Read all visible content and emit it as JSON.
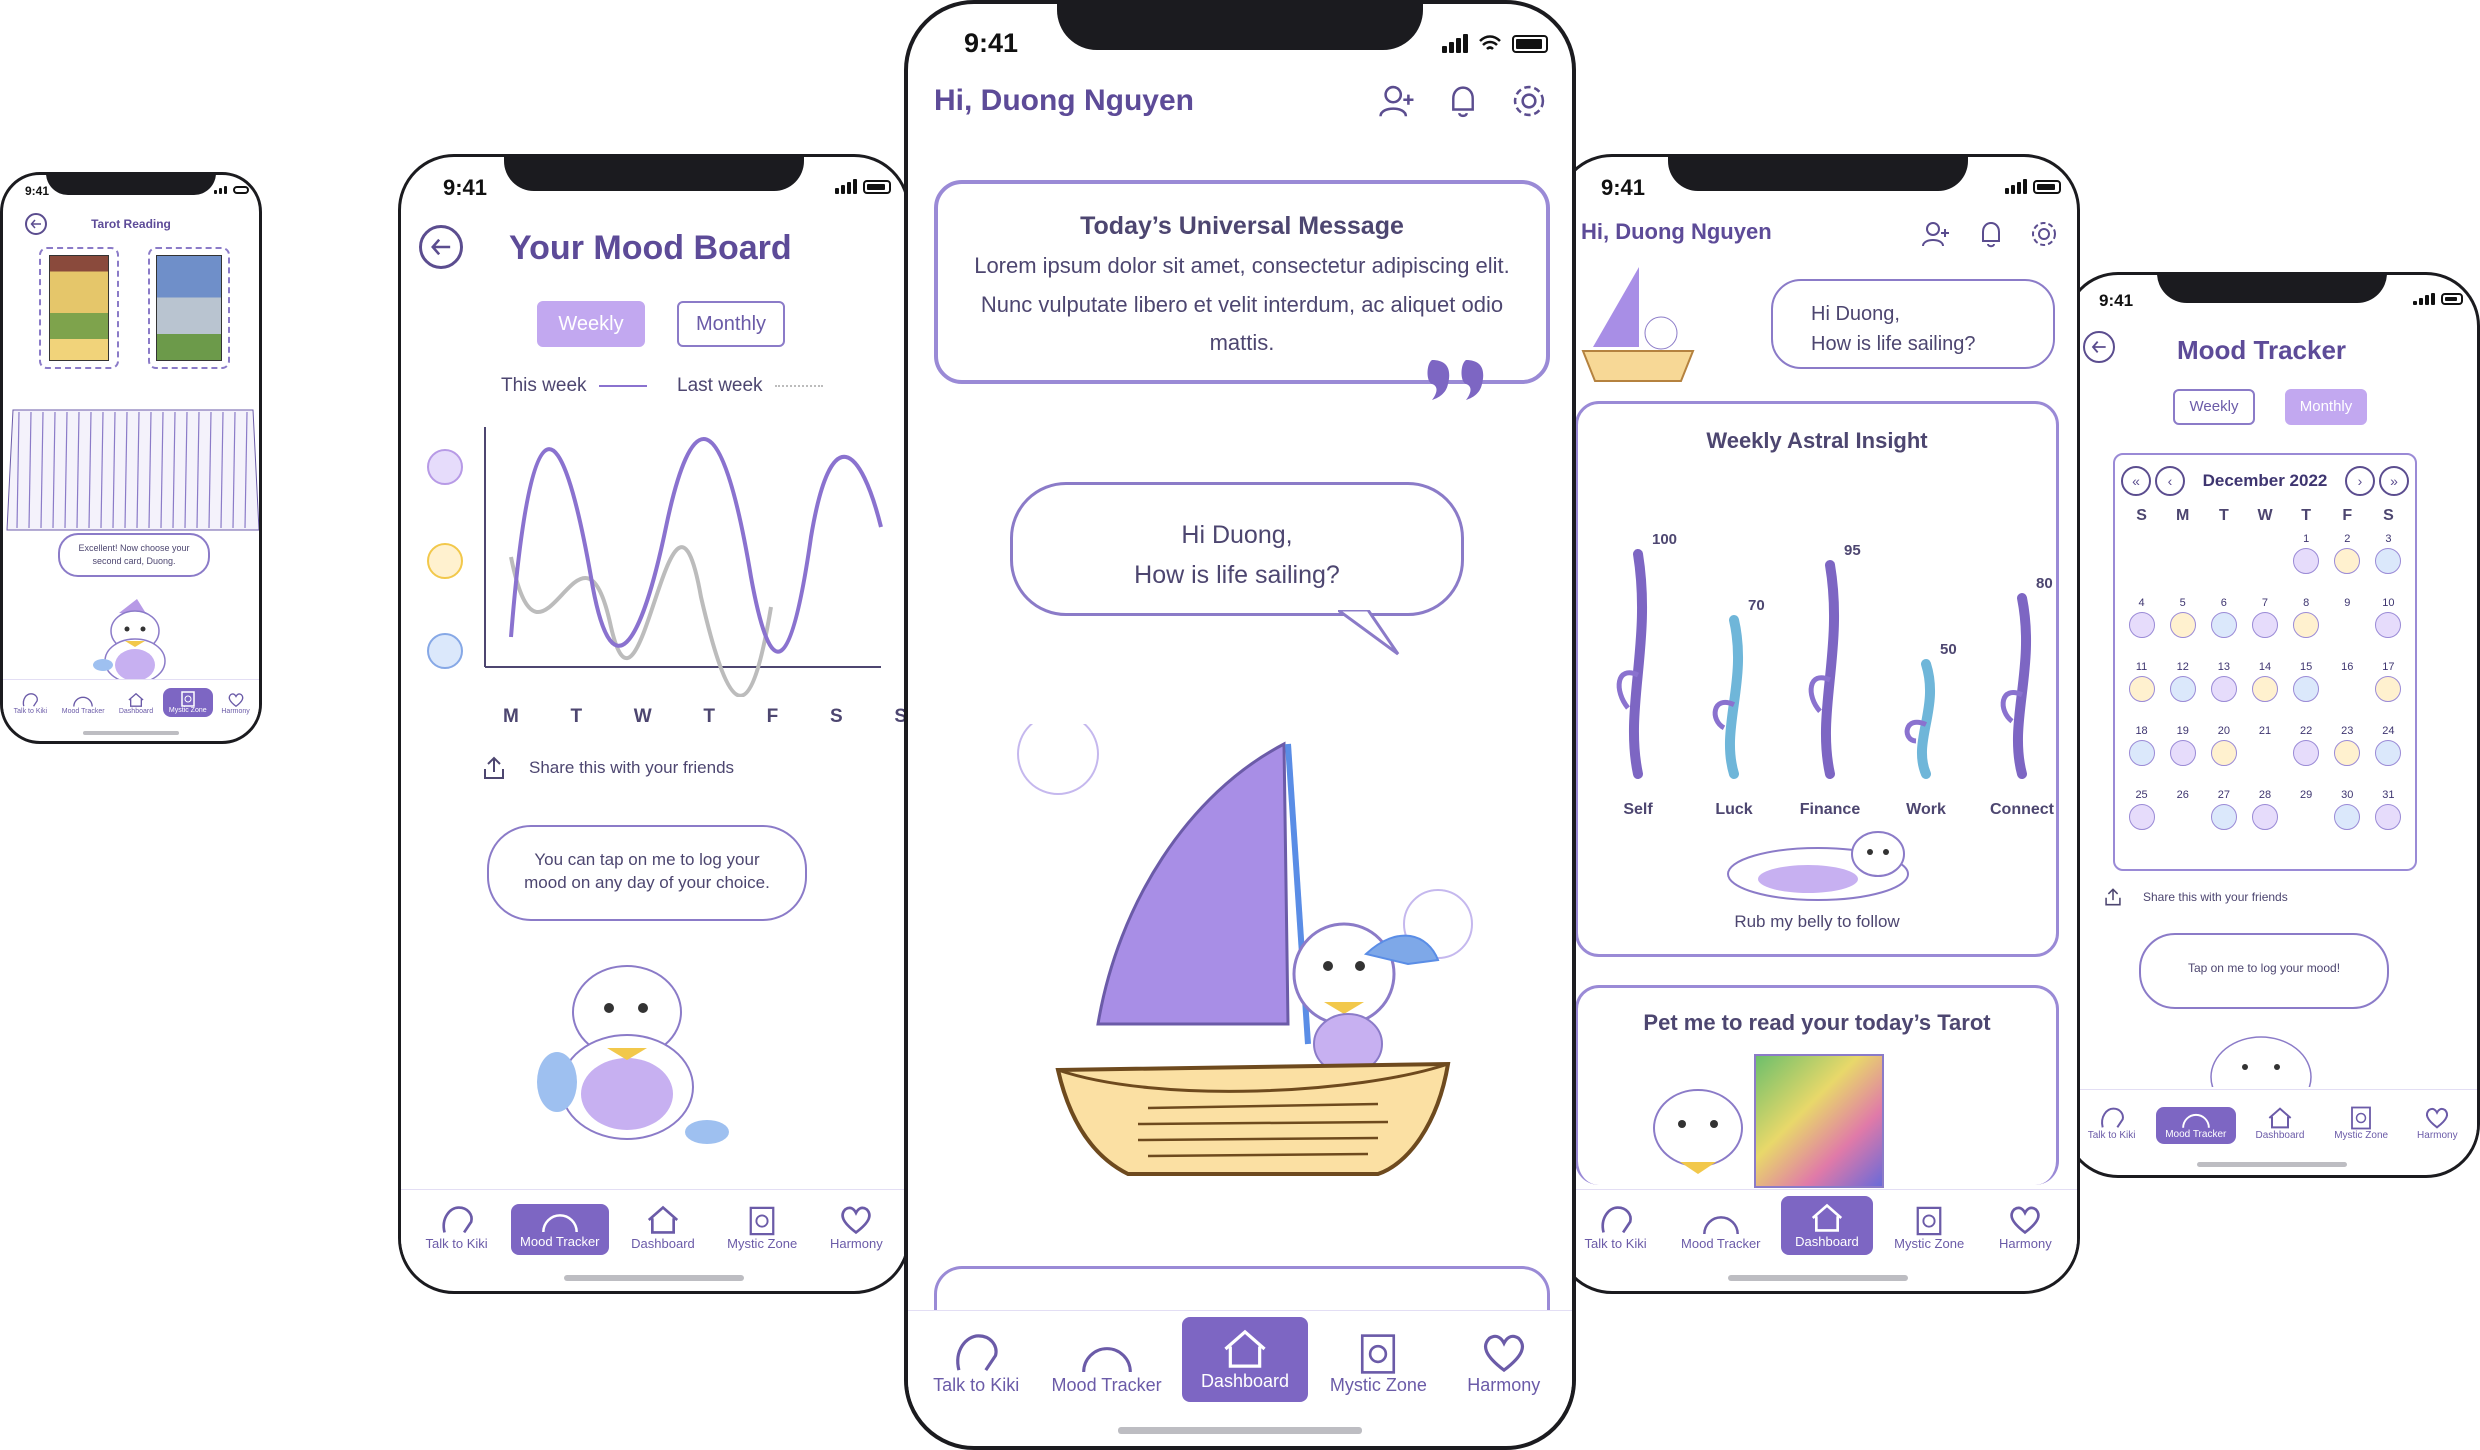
{
  "status_time": "9:41",
  "tabs": [
    "Talk to Kiki",
    "Mood Tracker",
    "Dashboard",
    "Mystic Zone",
    "Harmony"
  ],
  "tarot": {
    "title": "Tarot Reading",
    "bubble": "Excellent! Now choose your second card, Duong.",
    "active_tab": "Mystic Zone"
  },
  "mood_board": {
    "title": "Your Mood Board",
    "toggle": [
      "Weekly",
      "Monthly"
    ],
    "legend_this": "This week",
    "legend_last": "Last week",
    "days": [
      "M",
      "T",
      "W",
      "T",
      "F",
      "S",
      "S"
    ],
    "share": "Share this with your friends",
    "bubble": "You can tap on me to log your mood on any day of your choice.",
    "active_tab": "Mood Tracker"
  },
  "main": {
    "greeting": "Hi, Duong Nguyen",
    "message_title": "Today’s Universal Message",
    "message_body": "Lorem ipsum dolor sit amet, consectetur adipiscing elit. Nunc vulputate libero et velit interdum, ac aliquet odio mattis.",
    "bubble_line1": "Hi Duong,",
    "bubble_line2": "How is life sailing?",
    "active_tab": "Dashboard"
  },
  "dashboard": {
    "greeting": "Hi, Duong Nguyen",
    "bubble_line1": "Hi Duong,",
    "bubble_line2": "How is life sailing?",
    "insight_title": "Weekly Astral Insight",
    "insight": [
      {
        "label": "Self",
        "value": 100
      },
      {
        "label": "Luck",
        "value": 70
      },
      {
        "label": "Finance",
        "value": 95
      },
      {
        "label": "Work",
        "value": 50
      },
      {
        "label": "Connect",
        "value": 80
      }
    ],
    "rub": "Rub my belly to follow",
    "tarot_title": "Pet me to read your today’s Tarot",
    "active_tab": "Dashboard"
  },
  "mood_tracker": {
    "title": "Mood Tracker",
    "toggle": [
      "Weekly",
      "Monthly"
    ],
    "month": "December 2022",
    "weekdays": [
      "S",
      "M",
      "T",
      "W",
      "T",
      "F",
      "S"
    ],
    "dates": [
      "",
      "",
      "",
      "",
      "1",
      "2",
      "3",
      "4",
      "5",
      "6",
      "7",
      "8",
      "9",
      "10",
      "11",
      "12",
      "13",
      "14",
      "15",
      "16",
      "17",
      "18",
      "19",
      "20",
      "21",
      "22",
      "23",
      "24",
      "25",
      "26",
      "27",
      "28",
      "29",
      "30",
      "31"
    ],
    "share": "Share this with your friends",
    "bubble": "Tap on me to log your mood!",
    "active_tab": "Mood Tracker"
  },
  "colors": {
    "primary": "#7d66c3",
    "lavender": "#c2a8f0",
    "text": "#5d4b98",
    "this_week": "#8a72cf",
    "last_week": "#bcbcbc"
  }
}
